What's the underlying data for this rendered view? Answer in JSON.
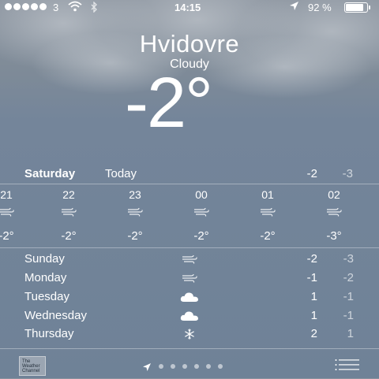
{
  "status_bar": {
    "carrier": "3",
    "time": "14:15",
    "battery_percent_label": "92 %",
    "battery_level": 0.92
  },
  "location": {
    "city": "Hvidovre",
    "condition": "Cloudy",
    "temperature": "-2°"
  },
  "today": {
    "day": "Saturday",
    "label": "Today",
    "high": "-2",
    "low": "-3"
  },
  "hourly": [
    {
      "hour": "21",
      "icon": "wind-icon",
      "temp": "-2°"
    },
    {
      "hour": "22",
      "icon": "wind-icon",
      "temp": "-2°"
    },
    {
      "hour": "23",
      "icon": "wind-icon",
      "temp": "-2°"
    },
    {
      "hour": "00",
      "icon": "wind-icon",
      "temp": "-2°"
    },
    {
      "hour": "01",
      "icon": "wind-icon",
      "temp": "-2°"
    },
    {
      "hour": "02",
      "icon": "wind-icon",
      "temp": "-3°"
    }
  ],
  "daily": [
    {
      "day": "Sunday",
      "icon": "wind-icon",
      "high": "-2",
      "low": "-3"
    },
    {
      "day": "Monday",
      "icon": "wind-icon",
      "high": "-1",
      "low": "-2"
    },
    {
      "day": "Tuesday",
      "icon": "cloud-icon",
      "high": "1",
      "low": "-1"
    },
    {
      "day": "Wednesday",
      "icon": "cloud-icon",
      "high": "1",
      "low": "-1"
    },
    {
      "day": "Thursday",
      "icon": "snowflake-icon",
      "high": "2",
      "low": "1"
    }
  ],
  "footer": {
    "provider_logo": "The Weather Channel",
    "page_count": 6
  }
}
